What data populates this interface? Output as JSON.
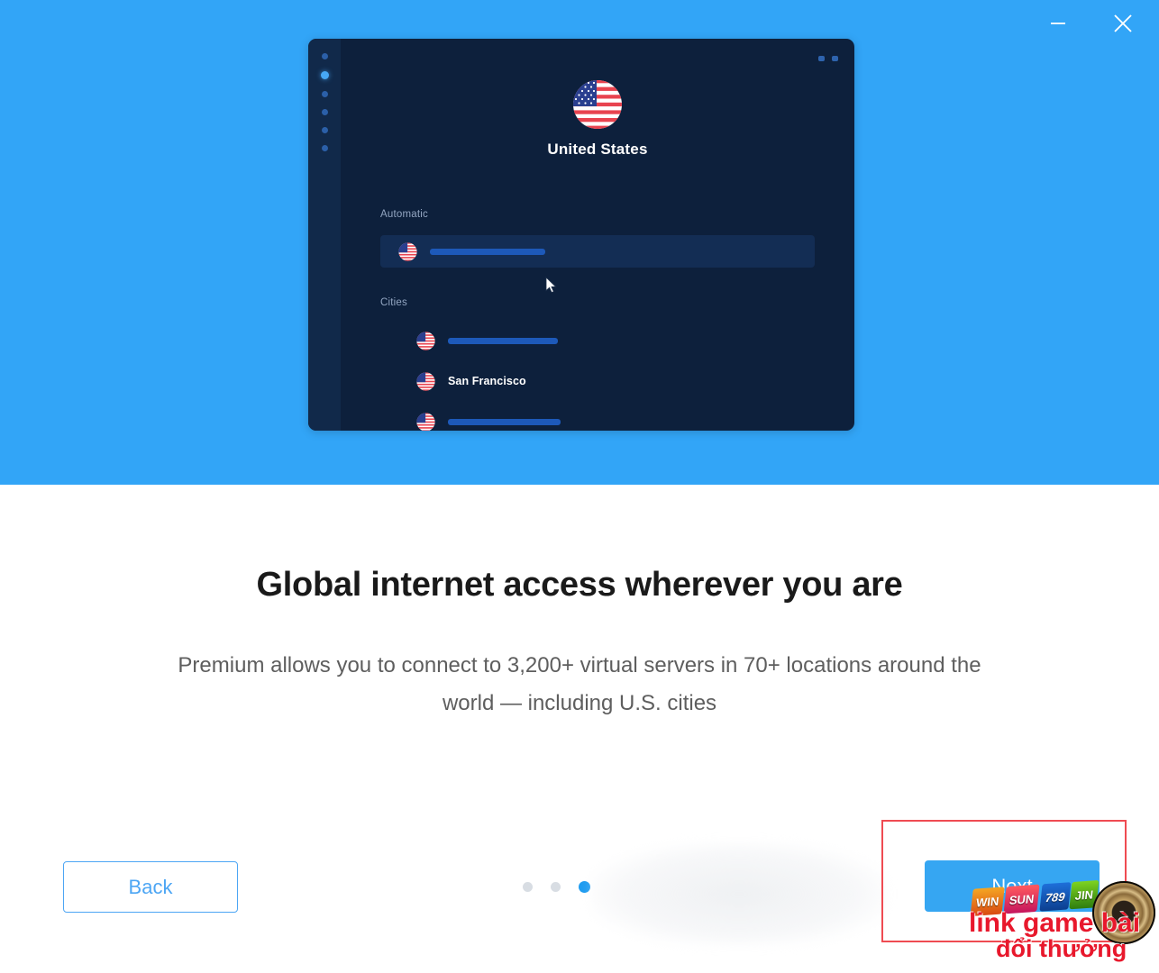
{
  "window_controls": {
    "minimize_label": "Minimize",
    "close_label": "Close"
  },
  "app_preview": {
    "country": "United States",
    "sidebar_dot_count": 6,
    "sidebar_active_index": 1,
    "sections": [
      {
        "label": "Automatic",
        "rows": [
          {
            "text": "",
            "redacted": true,
            "highlighted": true
          }
        ]
      },
      {
        "label": "Cities",
        "rows": [
          {
            "text": "",
            "redacted": true,
            "highlighted": false
          },
          {
            "text": "San Francisco",
            "redacted": false,
            "highlighted": false
          },
          {
            "text": "",
            "redacted": true,
            "highlighted": false
          }
        ]
      }
    ],
    "section_labels": {
      "automatic": "Automatic",
      "cities": "Cities"
    },
    "city_visible": "San Francisco",
    "flag_icon": "us-flag-icon",
    "cursor_icon": "mouse-pointer-icon"
  },
  "content": {
    "headline": "Global internet access wherever you are",
    "subhead": "Premium allows you to connect to 3,200+ virtual servers in 70+ locations around the world — including U.S. cities"
  },
  "footer": {
    "back_label": "Back",
    "next_label": "Next",
    "pagination": {
      "total": 3,
      "active_index": 2
    }
  },
  "annotation": {
    "shape": "rectangle",
    "color": "#ef4b52",
    "target": "next-button"
  },
  "watermark": {
    "line1": "link game bài",
    "line2": "đổi thưởng",
    "badges": [
      "WIN",
      "SUN",
      "789",
      "JIN"
    ],
    "wheel_icon": "roulette-wheel-icon",
    "color": "#e8182c"
  },
  "colors": {
    "hero_blue": "#32a5f7",
    "accent_blue": "#36a6f2",
    "app_dark": "#0d203c",
    "app_sidebar": "#11294a",
    "row_highlight": "#132d54",
    "redaction": "#1d59b9",
    "headline": "#1a1a1a",
    "subhead": "#5e5e5e",
    "annotation_red": "#ef4b52",
    "watermark_red": "#e8182c"
  }
}
